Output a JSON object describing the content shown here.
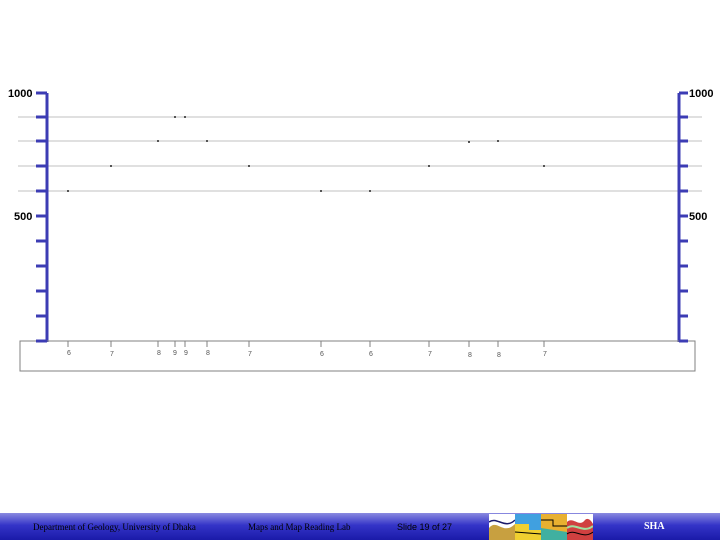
{
  "profile": {
    "y_axis": {
      "top_label": "1000",
      "mid_label": "500"
    },
    "contour_values": [
      "6",
      "7",
      "8",
      "9",
      "9",
      "8",
      "7",
      "6",
      "6",
      "7",
      "8",
      "8",
      "7"
    ]
  },
  "footer": {
    "department": "Department of Geology, University of Dhaka",
    "lab": "Maps and Map Reading Lab",
    "slide_number": "Slide 19 of 27",
    "author": "SHA"
  },
  "colors": {
    "axis": "#3c3cb4",
    "grid": "#c0c0c0",
    "footer_dark": "#1a1aa8"
  }
}
